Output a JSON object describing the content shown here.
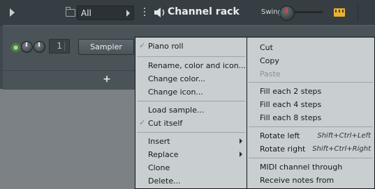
{
  "rack": {
    "filter_label": "All",
    "title": "Channel rack",
    "swing_label": "Swing",
    "channel": {
      "number": "1",
      "name": "Sampler"
    },
    "add_label": "+"
  },
  "menu_left": {
    "items": [
      {
        "label": "Piano roll",
        "checked": true
      },
      {
        "label": "Rename, color and icon..."
      },
      {
        "label": "Change color..."
      },
      {
        "label": "Change icon..."
      },
      {
        "label": "Load sample..."
      },
      {
        "label": "Cut itself",
        "checked": true
      },
      {
        "label": "Insert",
        "submenu": true
      },
      {
        "label": "Replace",
        "submenu": true
      },
      {
        "label": "Clone"
      },
      {
        "label": "Delete..."
      }
    ]
  },
  "menu_right": {
    "items": [
      {
        "label": "Cut"
      },
      {
        "label": "Copy"
      },
      {
        "label": "Paste",
        "disabled": true
      },
      {
        "label": "Fill each 2 steps"
      },
      {
        "label": "Fill each 4 steps"
      },
      {
        "label": "Fill each 8 steps"
      },
      {
        "label": "Rotate left",
        "shortcut": "Shift+Ctrl+Left"
      },
      {
        "label": "Rotate right",
        "shortcut": "Shift+Ctrl+Right"
      },
      {
        "label": "MIDI channel through"
      },
      {
        "label": "Receive notes from"
      }
    ]
  },
  "colors": {
    "rack_bg": "#3e474d",
    "menu_bg": "#c9ced0",
    "led_green": "#8fe36a",
    "accent_yellow": "#e9b233"
  }
}
